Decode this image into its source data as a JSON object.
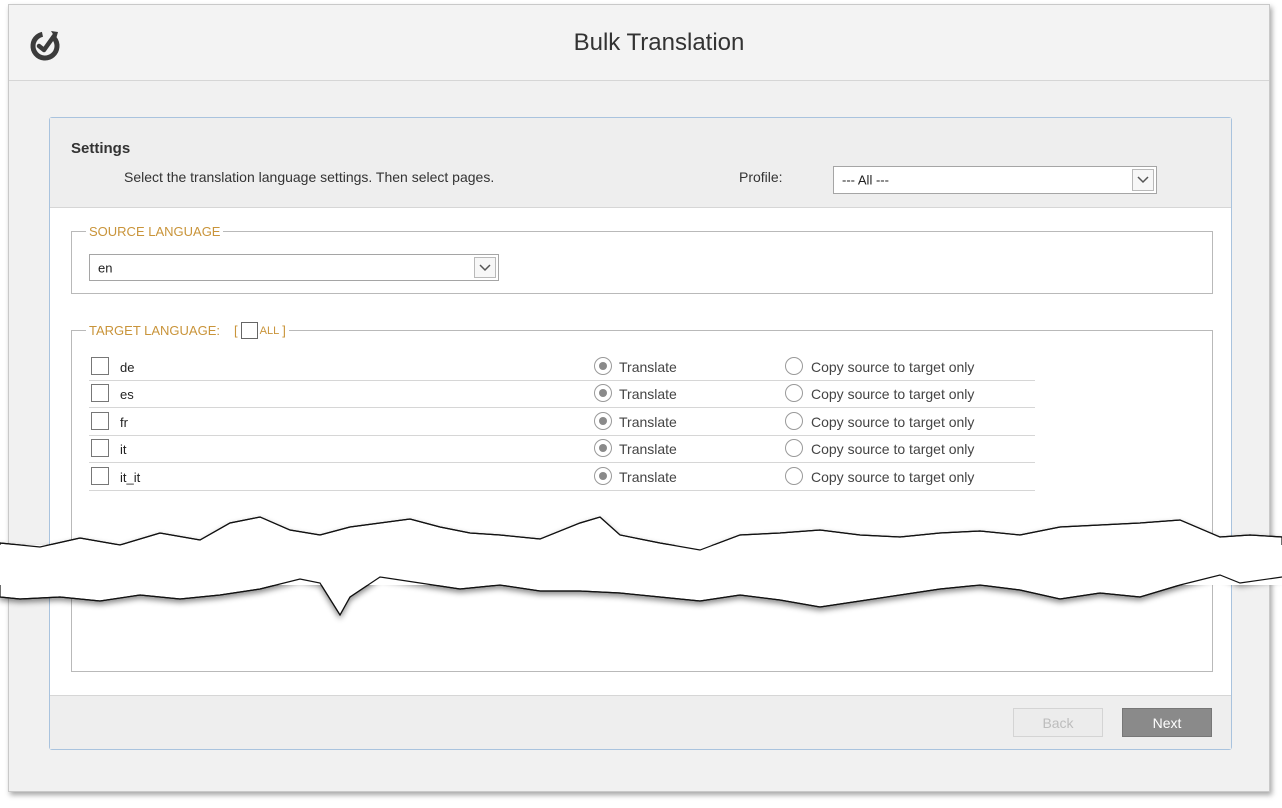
{
  "header": {
    "title": "Bulk Translation",
    "logo_icon": "refresh-check-logo-icon"
  },
  "settings": {
    "title": "Settings",
    "description": "Select the translation language settings. Then select pages.",
    "profile_label": "Profile:",
    "profile_value": "--- All ---"
  },
  "source_language": {
    "legend": "SOURCE LANGUAGE",
    "value": "en"
  },
  "target_language": {
    "legend": "TARGET LANGUAGE:",
    "bracket_open": "[",
    "all_label": "ALL",
    "bracket_close": "]",
    "all_checked": false,
    "translate_label": "Translate",
    "copy_label": "Copy source to target only",
    "languages": [
      {
        "code": "de",
        "checked": false,
        "mode": "translate"
      },
      {
        "code": "es",
        "checked": false,
        "mode": "translate"
      },
      {
        "code": "fr",
        "checked": false,
        "mode": "translate"
      },
      {
        "code": "it",
        "checked": false,
        "mode": "translate"
      },
      {
        "code": "it_it",
        "checked": false,
        "mode": "translate"
      }
    ]
  },
  "footer": {
    "back_label": "Back",
    "back_enabled": false,
    "next_label": "Next"
  },
  "colors": {
    "accent_legend": "#c9943a",
    "dialog_border": "#a9c3de",
    "next_button": "#8a8a8a"
  }
}
